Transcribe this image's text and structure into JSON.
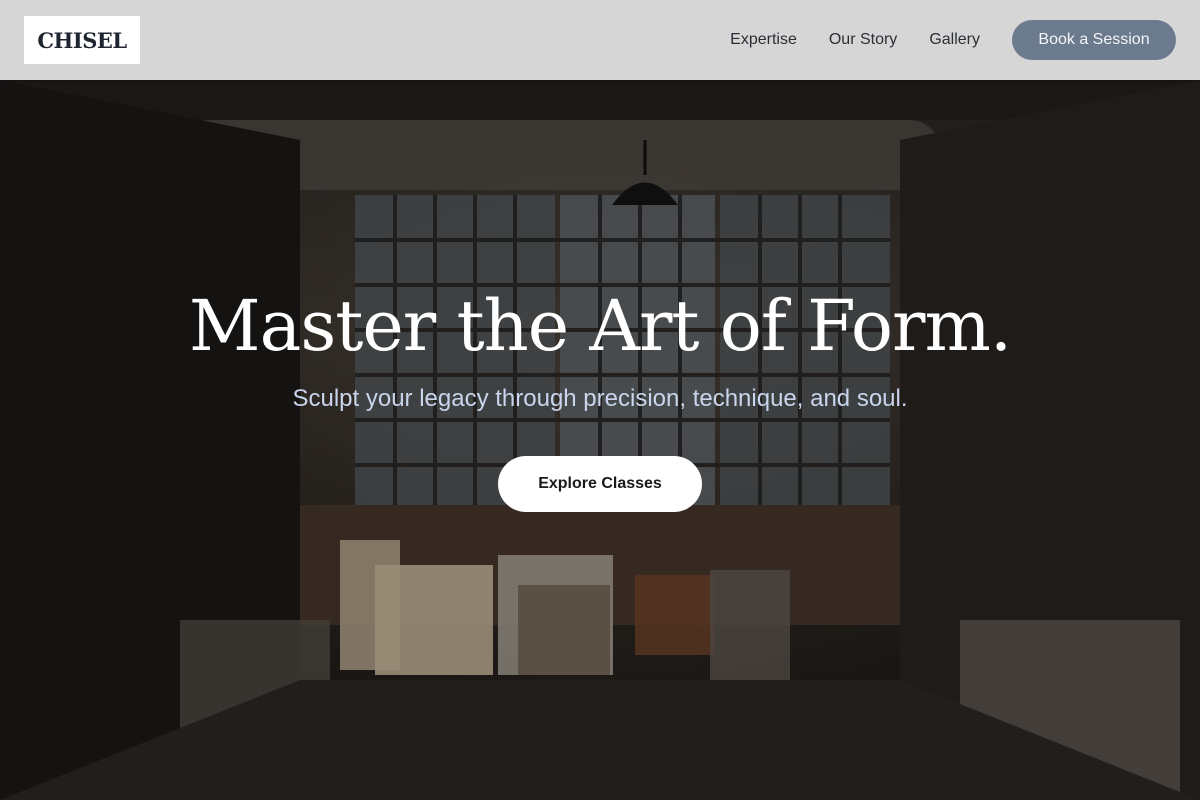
{
  "brand": {
    "logo_text": "CHISEL"
  },
  "nav": {
    "links": [
      "Expertise",
      "Our Story",
      "Gallery"
    ],
    "cta_label": "Book a Session"
  },
  "hero": {
    "title": "Master the Art of Form.",
    "subtitle": "Sculpt your legacy through precision, technique, and soul.",
    "button_label": "Explore Classes"
  },
  "colors": {
    "header_bg": "#d6d6d6",
    "cta_bg": "#6b7a8d",
    "subtitle_text": "#c9d5ec",
    "hero_button_bg": "#ffffff"
  }
}
